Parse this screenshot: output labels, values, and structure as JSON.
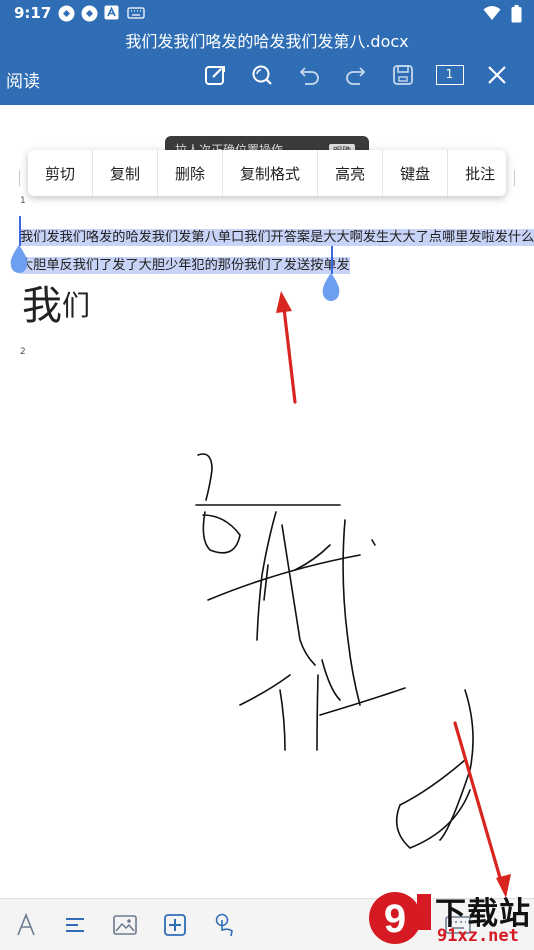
{
  "status_bar": {
    "time": "9:17"
  },
  "title_bar": {
    "title": "我们发我们咯发的哈发我们发第八.docx",
    "mode": "阅读",
    "page_indicator": "1"
  },
  "document": {
    "page1_label": "1",
    "line1": "我们发我们咯发的哈发我们发第八单口我们开答案是大大啊发生大大了点哪里发啦发什么",
    "line2": "大胆单反我们了发了大胆少年犯的那份我们了发送按单发",
    "big_text": "我",
    "big_text_small": "们",
    "page2_label": "2"
  },
  "hint": {
    "text": "拉人次正确位置操作",
    "tag": "明确"
  },
  "context_menu": {
    "items": [
      "剪切",
      "复制",
      "删除",
      "复制格式",
      "高亮",
      "键盘",
      "批注"
    ]
  },
  "bottom_toolbar": {
    "items": [
      "text-style",
      "paragraph",
      "image",
      "insert",
      "touch-mode",
      "keyboard"
    ]
  },
  "watermark": {
    "text": "下载站",
    "url": "91xz.net",
    "logo": "9"
  },
  "colors": {
    "header": "#2f6db5",
    "selection": "#c7d3f7",
    "arrow": "#d8251f"
  }
}
